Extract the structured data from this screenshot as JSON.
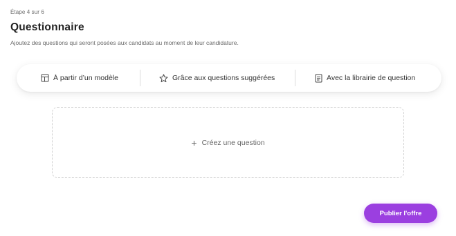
{
  "header": {
    "step": "Étape 4 sur 6",
    "title": "Questionnaire",
    "subtitle": "Ajoutez des questions qui seront posées aux candidats au moment de leur candidature."
  },
  "options": [
    {
      "label": "À partir d’un modèle",
      "icon": "template-icon"
    },
    {
      "label": "Grâce aux questions suggérées",
      "icon": "star-icon"
    },
    {
      "label": "Avec la librairie de question",
      "icon": "document-icon"
    }
  ],
  "dropzone": {
    "plus": "+",
    "label": "Créez une question"
  },
  "actions": {
    "publish_label": "Publier l'offre"
  },
  "colors": {
    "accent": "#9b3fe0",
    "text": "#333333",
    "muted": "#6b6b6b"
  }
}
